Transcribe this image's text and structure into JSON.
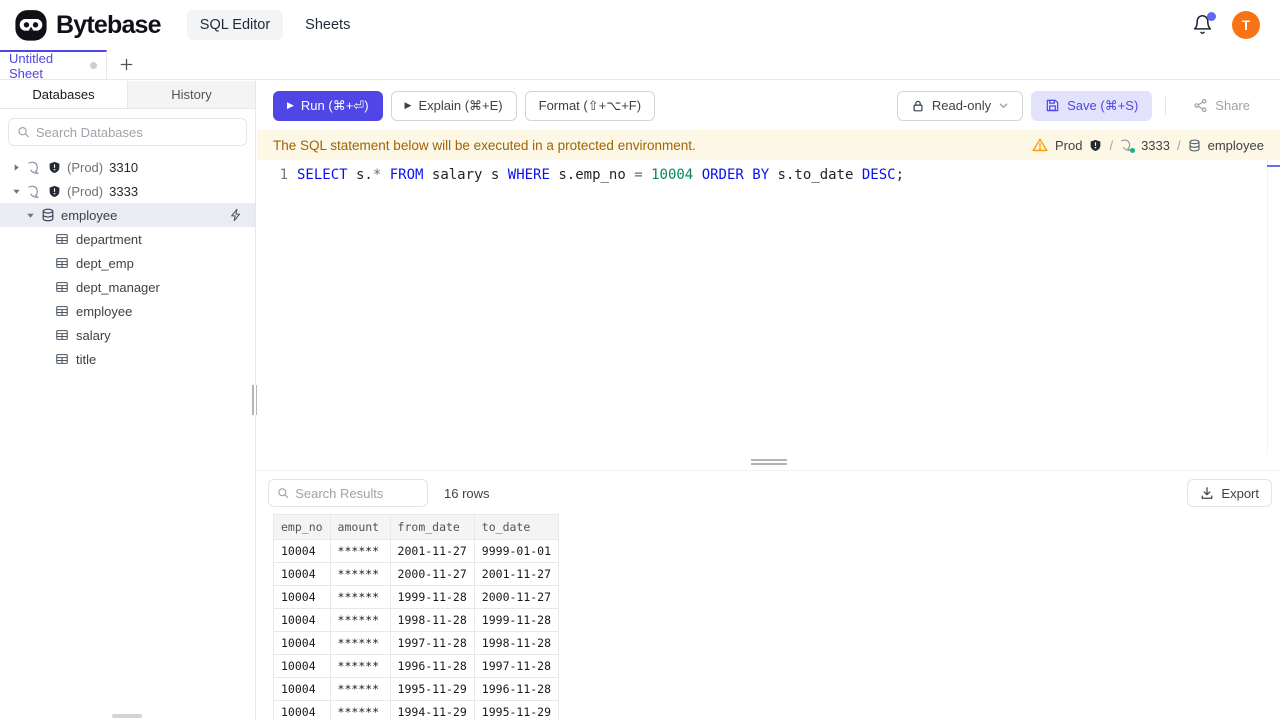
{
  "header": {
    "brand": "Bytebase",
    "nav_sql_editor": "SQL Editor",
    "nav_sheets": "Sheets",
    "avatar_initial": "T"
  },
  "tabs": {
    "active_tab": "Untitled Sheet"
  },
  "sidebar": {
    "tab_databases": "Databases",
    "tab_history": "History",
    "search_placeholder": "Search Databases",
    "instances": [
      {
        "env": "(Prod)",
        "name": "3310"
      },
      {
        "env": "(Prod)",
        "name": "3333"
      }
    ],
    "database": "employee",
    "tables": [
      "department",
      "dept_emp",
      "dept_manager",
      "employee",
      "salary",
      "title"
    ]
  },
  "toolbar": {
    "play_icon": "▶",
    "run_label": "Run (⌘+⏎)",
    "explain_label": "Explain (⌘+E)",
    "format_label": "Format (⇧+⌥+F)",
    "readonly_label": "Read-only",
    "save_label": "Save (⌘+S)",
    "share_label": "Share"
  },
  "banner": {
    "message": "The SQL statement below will be executed in a protected environment.",
    "env_label": "Prod",
    "separator": "/",
    "instance": "3333",
    "database": "employee"
  },
  "editor": {
    "line_number": "1",
    "sql_text": "SELECT s.* FROM salary s WHERE s.emp_no = 10004 ORDER BY s.to_date DESC;",
    "tokens": [
      {
        "text": "SELECT",
        "type": "keyword"
      },
      {
        "text": " s.",
        "type": "identifier"
      },
      {
        "text": "*",
        "type": "operator"
      },
      {
        "text": " ",
        "type": "identifier"
      },
      {
        "text": "FROM",
        "type": "keyword"
      },
      {
        "text": " salary s ",
        "type": "identifier"
      },
      {
        "text": "WHERE",
        "type": "keyword"
      },
      {
        "text": " s.emp_no ",
        "type": "identifier"
      },
      {
        "text": "=",
        "type": "operator"
      },
      {
        "text": " ",
        "type": "identifier"
      },
      {
        "text": "10004",
        "type": "number"
      },
      {
        "text": " ",
        "type": "identifier"
      },
      {
        "text": "ORDER BY",
        "type": "keyword"
      },
      {
        "text": " s.to_date ",
        "type": "identifier"
      },
      {
        "text": "DESC",
        "type": "keyword"
      },
      {
        "text": ";",
        "type": "identifier"
      }
    ]
  },
  "results": {
    "search_placeholder": "Search Results",
    "row_count_label": "16 rows",
    "export_label": "Export",
    "columns": [
      "emp_no",
      "amount",
      "from_date",
      "to_date"
    ],
    "rows": [
      [
        "10004",
        "******",
        "2001-11-27",
        "9999-01-01"
      ],
      [
        "10004",
        "******",
        "2000-11-27",
        "2001-11-27"
      ],
      [
        "10004",
        "******",
        "1999-11-28",
        "2000-11-27"
      ],
      [
        "10004",
        "******",
        "1998-11-28",
        "1999-11-28"
      ],
      [
        "10004",
        "******",
        "1997-11-28",
        "1998-11-28"
      ],
      [
        "10004",
        "******",
        "1996-11-28",
        "1997-11-28"
      ],
      [
        "10004",
        "******",
        "1995-11-29",
        "1996-11-28"
      ],
      [
        "10004",
        "******",
        "1994-11-29",
        "1995-11-29"
      ]
    ]
  },
  "colors": {
    "accent": "#4f46e5",
    "save_button_bg": "#e3e2fc",
    "banner_bg": "#fdf8e6",
    "banner_text": "#a16207",
    "warning_icon": "#f59e0b",
    "avatar_bg": "#f97316",
    "sql_keyword": "#0a0ff2",
    "sql_number": "#098658",
    "selected_row_bg": "#ebebf3"
  }
}
